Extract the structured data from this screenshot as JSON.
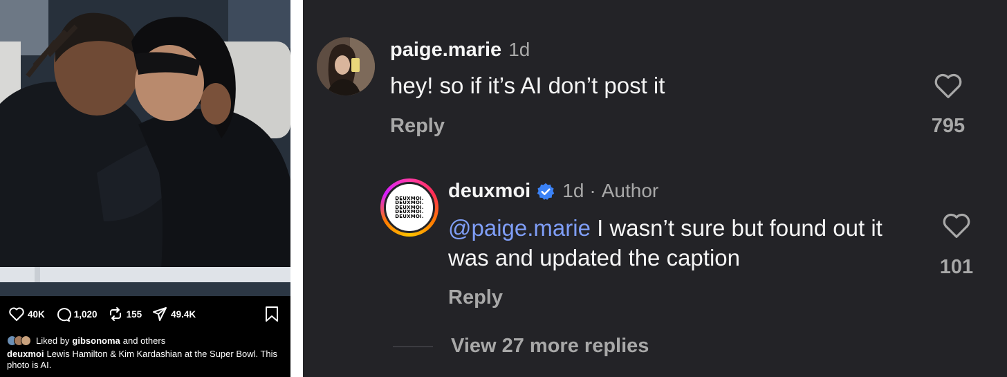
{
  "post": {
    "stats": {
      "likes": "40K",
      "comments": "1,020",
      "reposts": "155",
      "shares": "49.4K"
    },
    "liked_by": {
      "prefix": "Liked by",
      "user": "gibsonoma",
      "suffix": "and others"
    },
    "caption": {
      "username": "deuxmoi",
      "text": "Lewis Hamilton & Kim Kardashian at the Super Bowl. This photo is AI."
    },
    "icons": [
      "heart-icon",
      "comment-icon",
      "repost-icon",
      "share-icon",
      "bookmark-icon"
    ]
  },
  "comments": [
    {
      "username": "paige.marie",
      "time": "1d",
      "text": "hey! so if it’s AI don’t post it",
      "reply_label": "Reply",
      "likes": "795"
    },
    {
      "username": "deuxmoi",
      "verified": true,
      "time": "1d",
      "separator": "·",
      "author_tag": "Author",
      "mention": "@paige.marie",
      "text": "I wasn’t sure but found out it was and updated the caption",
      "reply_label": "Reply",
      "likes": "101",
      "avatar_logo_text": [
        "DEUXMOI.",
        "DEUXMOI.",
        "DEUXMOI.",
        "DEUXMOI.",
        "DEUXMOI."
      ]
    }
  ],
  "view_more_replies": "View 27 more replies",
  "colors": {
    "comments_bg": "#232327",
    "mention": "#7f9ef7",
    "verified": "#3b82f6",
    "muted_text": "#a8a8a8"
  }
}
